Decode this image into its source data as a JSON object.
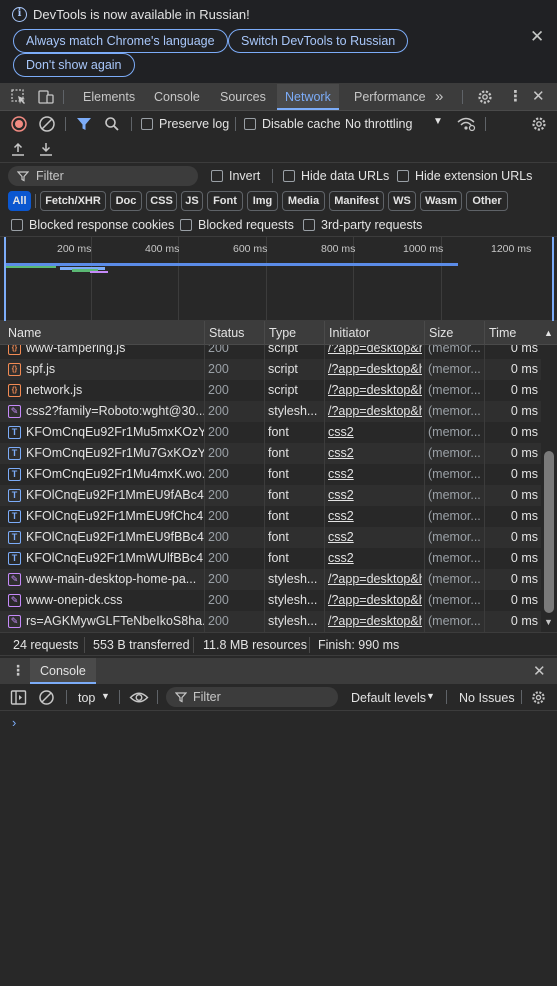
{
  "banner": {
    "message": "DevTools is now available in Russian!",
    "match_language": "Always match Chrome's language",
    "switch_language": "Switch DevTools to Russian",
    "dont_show": "Don't show again"
  },
  "tabs": [
    "Elements",
    "Console",
    "Sources",
    "Network",
    "Performance"
  ],
  "active_tab": "Network",
  "toolbar": {
    "preserve_log": "Preserve log",
    "disable_cache": "Disable cache",
    "throttling": "No throttling"
  },
  "filter": {
    "placeholder": "Filter",
    "invert": "Invert",
    "hide_data_urls": "Hide data URLs",
    "hide_extension_urls": "Hide extension URLs"
  },
  "type_chips": [
    "All",
    "Fetch/XHR",
    "Doc",
    "CSS",
    "JS",
    "Font",
    "Img",
    "Media",
    "Manifest",
    "WS",
    "Wasm",
    "Other"
  ],
  "active_chip": "All",
  "blocked": {
    "blocked_cookies": "Blocked response cookies",
    "blocked_requests": "Blocked requests",
    "third_party": "3rd-party requests"
  },
  "overview_ticks": [
    "200 ms",
    "400 ms",
    "600 ms",
    "800 ms",
    "1000 ms",
    "1200 ms"
  ],
  "table": {
    "columns": [
      "Name",
      "Status",
      "Type",
      "Initiator",
      "Size",
      "Time"
    ],
    "rows": [
      {
        "kind": "script",
        "name": "www-tampering.js",
        "status": "200",
        "type": "script",
        "initiator": "/?app=desktop&h",
        "size": "(memor...",
        "time": "0 ms"
      },
      {
        "kind": "script",
        "name": "spf.js",
        "status": "200",
        "type": "script",
        "initiator": "/?app=desktop&h",
        "size": "(memor...",
        "time": "0 ms"
      },
      {
        "kind": "script",
        "name": "network.js",
        "status": "200",
        "type": "script",
        "initiator": "/?app=desktop&h",
        "size": "(memor...",
        "time": "0 ms"
      },
      {
        "kind": "style",
        "name": "css2?family=Roboto:wght@30...",
        "status": "200",
        "type": "stylesh...",
        "initiator": "/?app=desktop&h",
        "size": "(memor...",
        "time": "0 ms"
      },
      {
        "kind": "font",
        "name": "KFOmCnqEu92Fr1Mu5mxKOzY...",
        "status": "200",
        "type": "font",
        "initiator": "css2",
        "size": "(memor...",
        "time": "0 ms"
      },
      {
        "kind": "font",
        "name": "KFOmCnqEu92Fr1Mu7GxKOzY...",
        "status": "200",
        "type": "font",
        "initiator": "css2",
        "size": "(memor...",
        "time": "0 ms"
      },
      {
        "kind": "font",
        "name": "KFOmCnqEu92Fr1Mu4mxK.wo...",
        "status": "200",
        "type": "font",
        "initiator": "css2",
        "size": "(memor...",
        "time": "0 ms"
      },
      {
        "kind": "font",
        "name": "KFOlCnqEu92Fr1MmEU9fABc4...",
        "status": "200",
        "type": "font",
        "initiator": "css2",
        "size": "(memor...",
        "time": "0 ms"
      },
      {
        "kind": "font",
        "name": "KFOlCnqEu92Fr1MmEU9fChc4...",
        "status": "200",
        "type": "font",
        "initiator": "css2",
        "size": "(memor...",
        "time": "0 ms"
      },
      {
        "kind": "font",
        "name": "KFOlCnqEu92Fr1MmEU9fBBc4...",
        "status": "200",
        "type": "font",
        "initiator": "css2",
        "size": "(memor...",
        "time": "0 ms"
      },
      {
        "kind": "font",
        "name": "KFOlCnqEu92Fr1MmWUlfBBc4...",
        "status": "200",
        "type": "font",
        "initiator": "css2",
        "size": "(memor...",
        "time": "0 ms"
      },
      {
        "kind": "style",
        "name": "www-main-desktop-home-pa...",
        "status": "200",
        "type": "stylesh...",
        "initiator": "/?app=desktop&h",
        "size": "(memor...",
        "time": "0 ms"
      },
      {
        "kind": "style",
        "name": "www-onepick.css",
        "status": "200",
        "type": "stylesh...",
        "initiator": "/?app=desktop&h",
        "size": "(memor...",
        "time": "0 ms"
      },
      {
        "kind": "style",
        "name": "rs=AGKMywGLFTeNbeIkoS8ha...",
        "status": "200",
        "type": "stylesh...",
        "initiator": "/?app=desktop&h",
        "size": "(memor...",
        "time": "0 ms"
      }
    ]
  },
  "summary": {
    "requests": "24 requests",
    "transferred": "553 B transferred",
    "resources": "11.8 MB resources",
    "finish": "Finish: 990 ms"
  },
  "drawer": {
    "tab": "Console",
    "context": "top",
    "filter_placeholder": "Filter",
    "levels": "Default levels",
    "issues": "No Issues"
  },
  "colors": {
    "accent": "#7cacf8",
    "record": "#f28b82",
    "script_icon": "#f28b54",
    "style_icon": "#c58af9",
    "font_icon": "#7cacf8"
  }
}
